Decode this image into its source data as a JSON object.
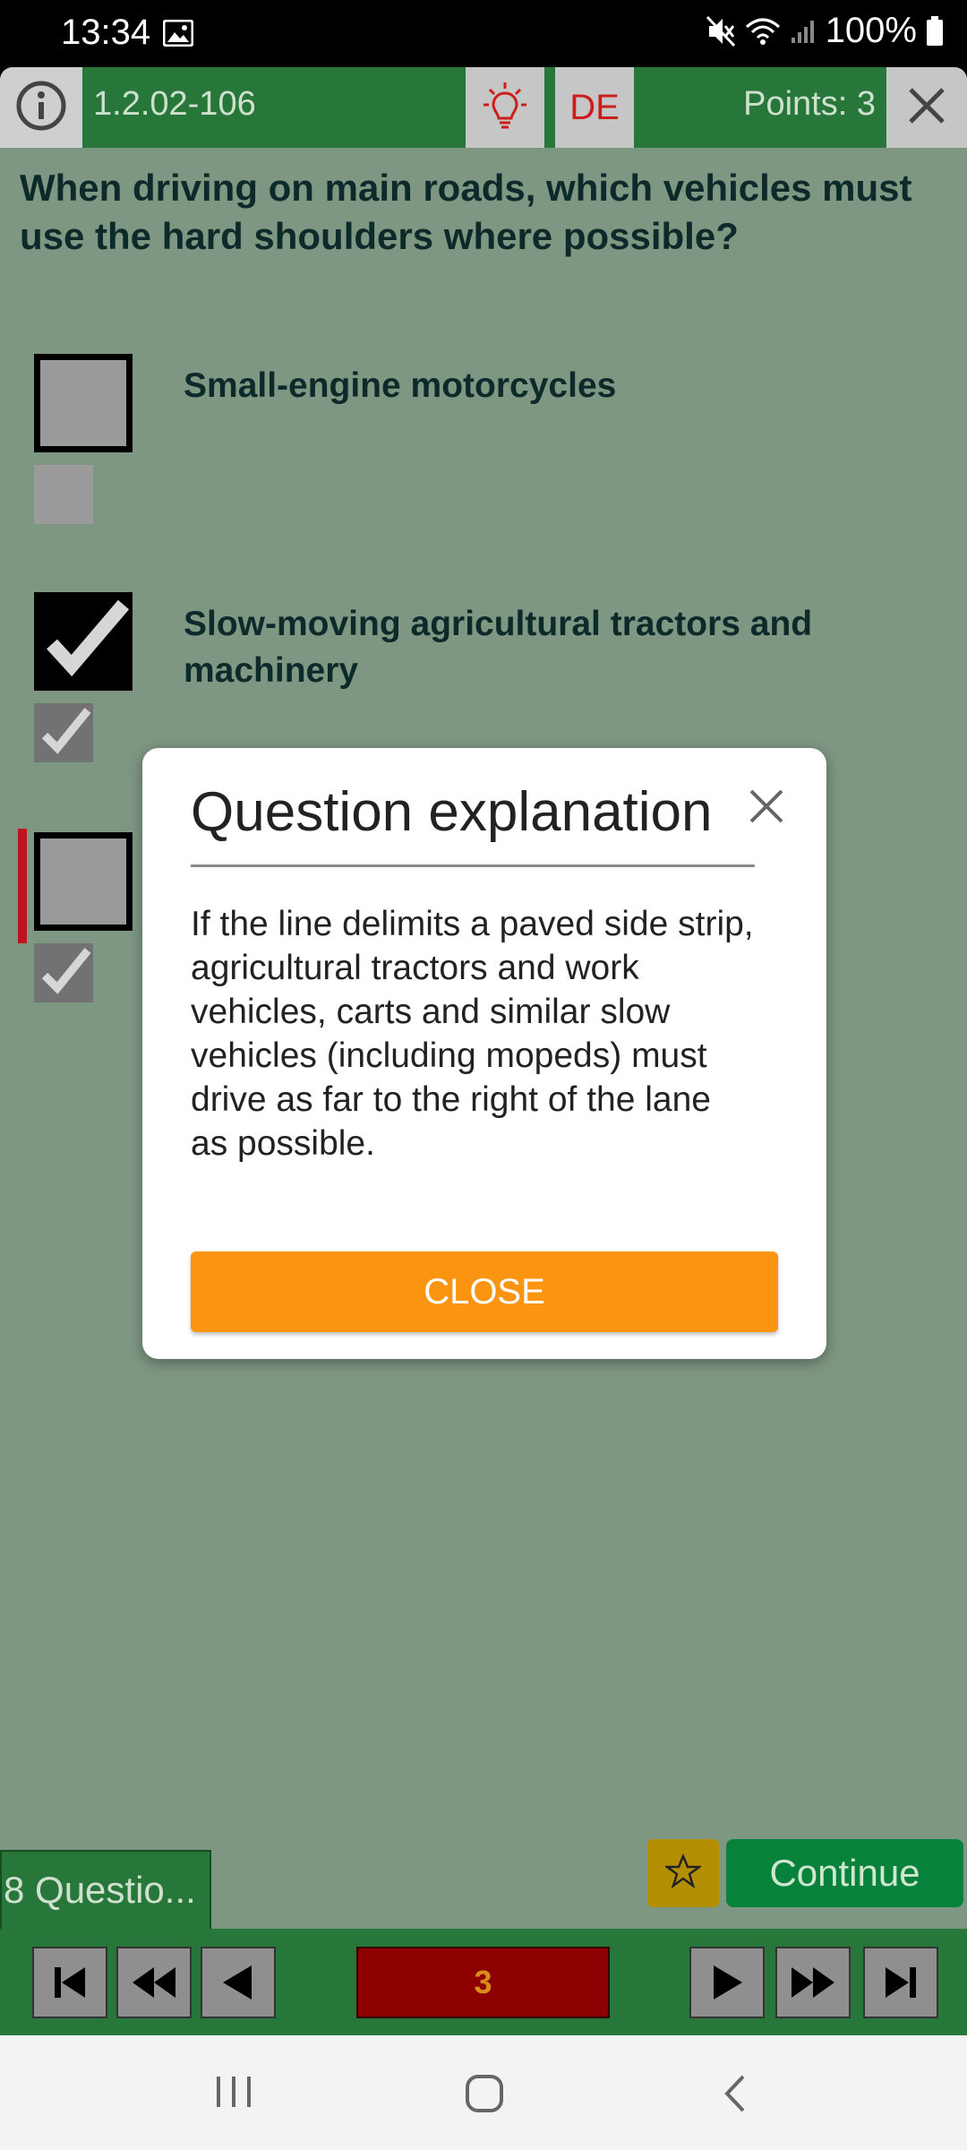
{
  "status_bar": {
    "time": "13:34",
    "battery": "100%"
  },
  "toolbar": {
    "question_id": "1.2.02-106",
    "language": "DE",
    "points": "Points: 3"
  },
  "question": {
    "text": "When driving on main roads, which vehicles must use the hard shoulders where possible?",
    "answers": [
      {
        "text": "Small-engine motorcycles",
        "user_checked": false,
        "solution_checked": false
      },
      {
        "text": "Slow-moving agricultural tractors and machinery",
        "user_checked": true,
        "solution_checked": true
      },
      {
        "text": "",
        "user_checked": false,
        "solution_checked": true,
        "marked_wrong": true
      }
    ]
  },
  "footer": {
    "questions_tab": "8 Questio...",
    "continue": "Continue",
    "current_page": "3"
  },
  "dialog": {
    "title": "Question explanation",
    "body": "If the line delimits a paved side strip, agricultural tractors and work vehicles, carts and similar slow vehicles (including mopeds) must drive as far to the right of the lane as possible.",
    "close_button": "CLOSE"
  },
  "colors": {
    "header_green": "#27773a",
    "background": "#7e9783",
    "accent_orange": "#fb9410",
    "continue_green": "#06823a",
    "page_red": "#8d0000"
  }
}
